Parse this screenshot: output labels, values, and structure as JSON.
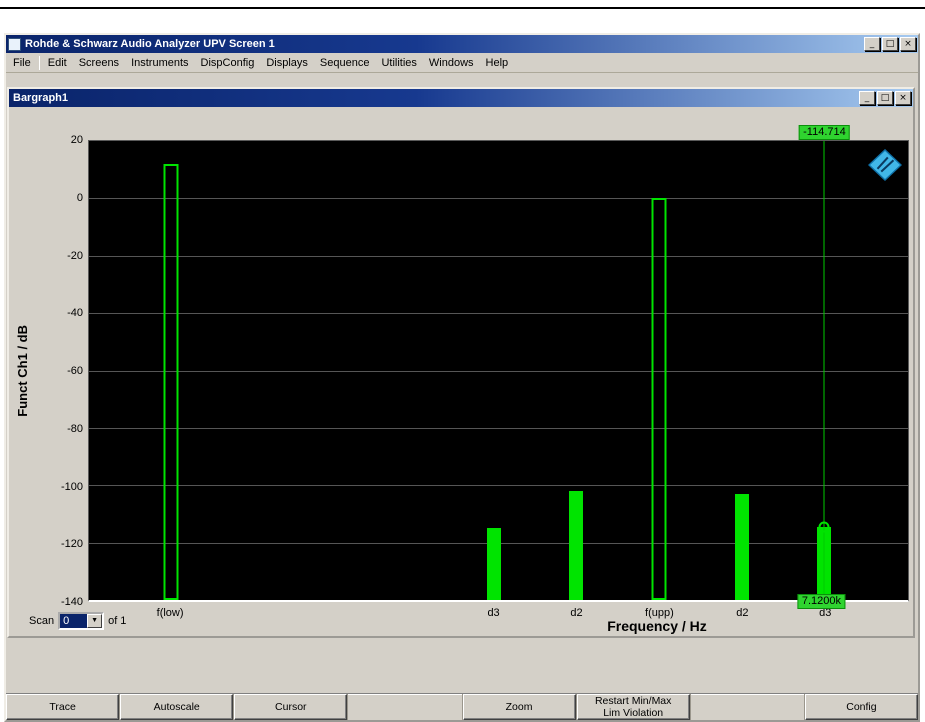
{
  "app_window": {
    "title": "Rohde & Schwarz Audio Analyzer UPV Screen 1",
    "window_buttons": {
      "minimize": "_",
      "restore": "□",
      "close": "×"
    }
  },
  "menu": {
    "items": [
      "File",
      "Edit",
      "Screens",
      "Instruments",
      "DispConfig",
      "Displays",
      "Sequence",
      "Utilities",
      "Windows",
      "Help"
    ]
  },
  "bargraph_window": {
    "title": "Bargraph1",
    "window_buttons": {
      "minimize": "_",
      "maximize": "□",
      "close": "×"
    }
  },
  "chart_data": {
    "type": "bar",
    "title": "Bargraph1",
    "ylabel": "Funct Ch1 / dB",
    "xlabel": "Frequency / Hz",
    "ylim": [
      -140,
      20
    ],
    "yticks": [
      20,
      0,
      -20,
      -40,
      -60,
      -80,
      -100,
      -120,
      -140
    ],
    "grid": true,
    "plot_bg": "#000000",
    "bar_color": "#00e400",
    "categories": [
      "f(low)",
      "d3",
      "d2",
      "f(upp)",
      "d2",
      "d3"
    ],
    "values": [
      12,
      -115,
      -102,
      0,
      -103,
      -114.714
    ],
    "bar_styles": [
      "outline",
      "solid",
      "solid",
      "outline",
      "solid",
      "solid"
    ],
    "x_positions_frac": [
      0.1,
      0.494,
      0.595,
      0.696,
      0.797,
      0.898
    ],
    "cursor": {
      "index": 5,
      "value_label": "-114.714",
      "x_label": "7.1200k"
    }
  },
  "scan": {
    "label": "Scan",
    "value": "0",
    "dropdown_icon": "▼",
    "suffix": "of 1"
  },
  "softkeys": [
    "Trace",
    "Autoscale",
    "Cursor",
    "",
    "Zoom",
    "Restart Min/Max\nLim Violation",
    "",
    "Config"
  ]
}
